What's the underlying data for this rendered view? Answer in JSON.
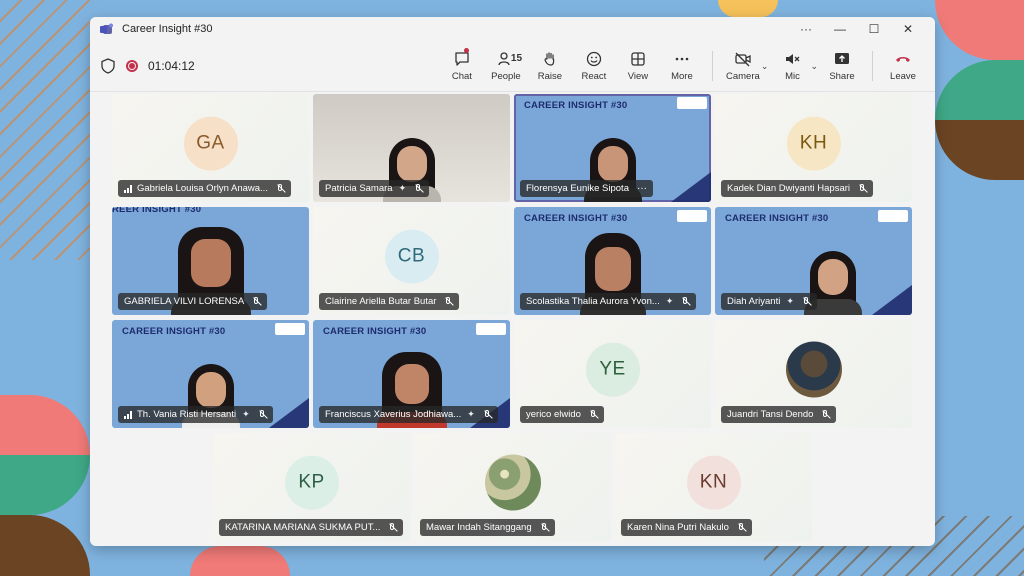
{
  "window": {
    "title": "Career Insight #30",
    "controls": [
      "···",
      "—",
      "☐",
      "✕"
    ]
  },
  "toolbar": {
    "timer": "01:04:12",
    "people_count": "15",
    "tools": {
      "chat": "Chat",
      "people": "People",
      "raise": "Raise",
      "react": "React",
      "view": "View",
      "more": "More",
      "camera": "Camera",
      "mic": "Mic",
      "share": "Share",
      "leave": "Leave"
    }
  },
  "banner_text": "CAREER INSIGHT #30",
  "banner_text_cropped": "REER INSIGHT #30",
  "participants": [
    {
      "name": "Gabriela Louisa Orlyn Anawa...",
      "initials": "GA",
      "avatar_color": "#f6e0c8",
      "initials_color": "#8a5a2a"
    },
    {
      "name": "Patricia Samara"
    },
    {
      "name": "Florensya Eunike Sipota"
    },
    {
      "name": "Kadek Dian Dwiyanti Hapsari",
      "initials": "KH",
      "avatar_color": "#f6e6c4",
      "initials_color": "#7a5a10"
    },
    {
      "name": "GABRIELA VILVI LORENSA"
    },
    {
      "name": "Clairine Ariella Butar Butar",
      "initials": "CB",
      "avatar_color": "#d9ecf2",
      "initials_color": "#2e6a7a"
    },
    {
      "name": "Scolastika Thalia Aurora Yvon..."
    },
    {
      "name": "Diah Ariyanti"
    },
    {
      "name": "Th. Vania Risti Hersanti"
    },
    {
      "name": "Franciscus Xaverius Jodhiawa..."
    },
    {
      "name": "yerico elwido",
      "initials": "YE",
      "avatar_color": "#dbece0",
      "initials_color": "#2c5f3c"
    },
    {
      "name": "Juandri Tansi Dendo"
    },
    {
      "name": "KATARINA MARIANA SUKMA PUT...",
      "initials": "KP",
      "avatar_color": "#dcefe6",
      "initials_color": "#2c5f45"
    },
    {
      "name": "Mawar Indah Sitanggang"
    },
    {
      "name": "Karen Nina Putri Nakulo",
      "initials": "KN",
      "avatar_color": "#f2e0dc",
      "initials_color": "#6a3a2e"
    }
  ],
  "colors": {
    "accent": "#6264a7",
    "recording": "#c4314b",
    "leave": "#c4314b",
    "banner_navy": "#1e2b6e"
  }
}
